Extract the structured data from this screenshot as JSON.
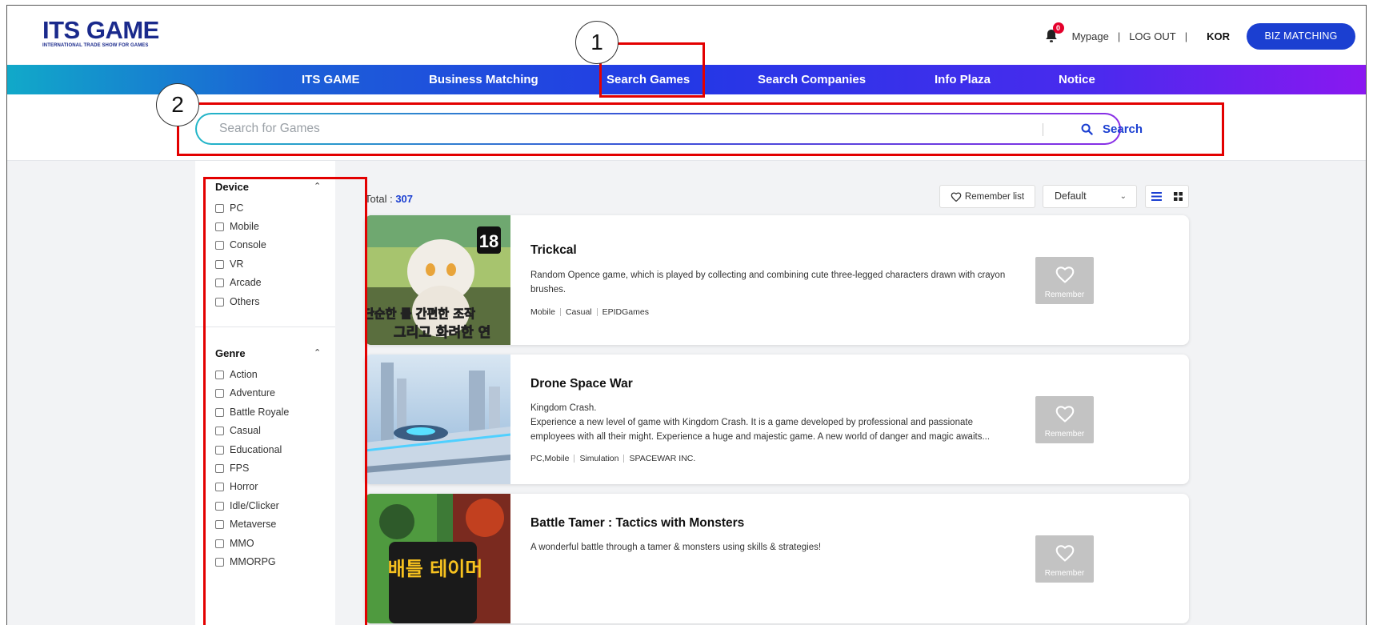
{
  "header": {
    "logo_main": "ITS GAME",
    "logo_sub": "INTERNATIONAL TRADE SHOW FOR GAMES",
    "notification_count": "0",
    "mypage": "Mypage",
    "sep1": "|",
    "logout": "LOG OUT",
    "sep2": "|",
    "lang": "KOR",
    "biz_button": "BIZ MATCHING"
  },
  "nav": {
    "items": [
      {
        "label": "ITS GAME"
      },
      {
        "label": "Business Matching"
      },
      {
        "label": "Search Games"
      },
      {
        "label": "Search Companies"
      },
      {
        "label": "Info Plaza"
      },
      {
        "label": "Notice"
      }
    ]
  },
  "search": {
    "placeholder": "Search for Games",
    "button_label": "Search"
  },
  "filters": {
    "device": {
      "title": "Device",
      "options": [
        "PC",
        "Mobile",
        "Console",
        "VR",
        "Arcade",
        "Others"
      ]
    },
    "genre": {
      "title": "Genre",
      "options": [
        "Action",
        "Adventure",
        "Battle Royale",
        "Casual",
        "Educational",
        "FPS",
        "Horror",
        "Idle/Clicker",
        "Metaverse",
        "MMO",
        "MMORPG"
      ]
    }
  },
  "list": {
    "total_label": "Total :",
    "total_count": "307",
    "remember_list_label": "Remember list",
    "sort_value": "Default",
    "remember_btn_label": "Remember"
  },
  "games": [
    {
      "title": "Trickcal",
      "desc": "Random Opence game, which is played by collecting and combining cute three-legged characters drawn with crayon brushes.",
      "tags": [
        "Mobile",
        "Casual",
        "EPIDGames"
      ]
    },
    {
      "title": "Drone Space War",
      "desc": "Kingdom Crash.\nExperience a new level of game with Kingdom Crash. It is a game developed by professional and passionate employees with all their might. Experience a huge and majestic game. A new world of danger and magic awaits...",
      "tags": [
        "PC,Mobile",
        "Simulation",
        "SPACEWAR INC."
      ]
    },
    {
      "title": "Battle Tamer : Tactics with Monsters",
      "desc": "A wonderful battle through a tamer & monsters using skills & strategies!",
      "tags": []
    }
  ],
  "thumb_text": {
    "trickcal_line1": "단순한 룰 간편한 조작",
    "trickcal_line2": "그리고 화려한 연",
    "trickcal_rating": "18",
    "battle_tamer": "배틀 테이머"
  },
  "annotations": {
    "marker1": "1",
    "marker2": "2",
    "color": "#e30000"
  }
}
